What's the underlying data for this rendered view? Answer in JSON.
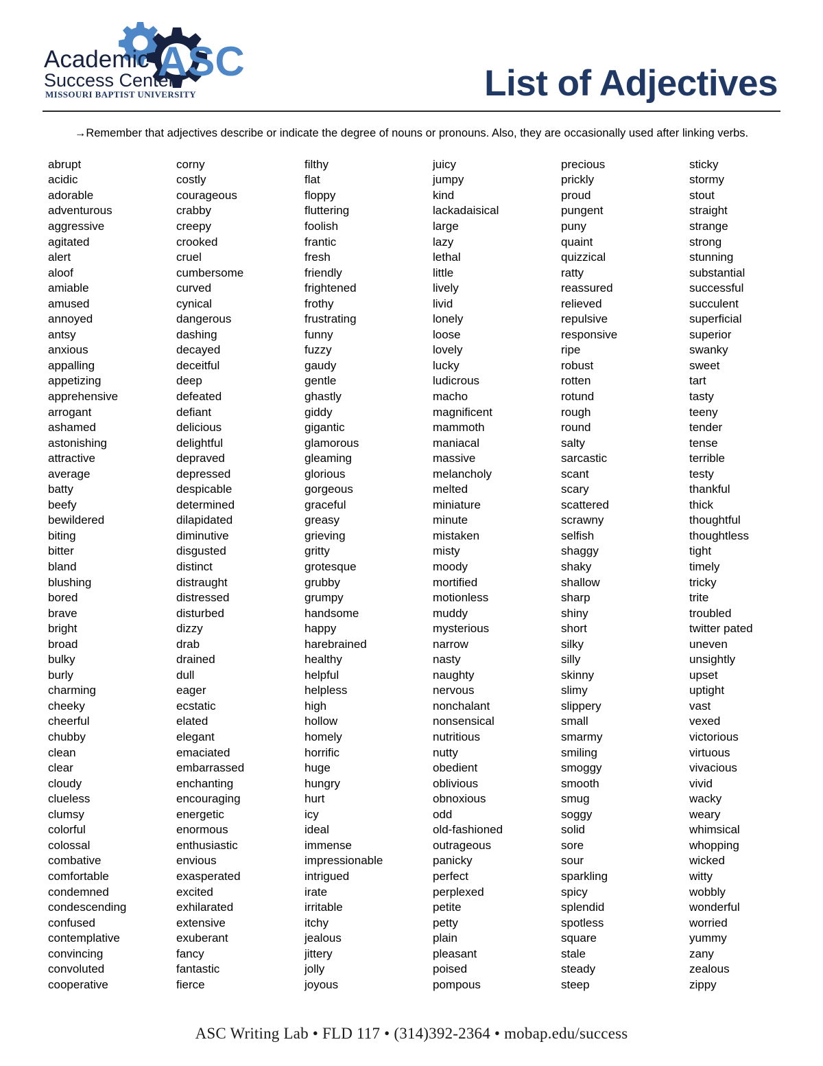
{
  "header": {
    "title": "List of Adjectives",
    "logo": {
      "line1": "Academic",
      "line2": "Success Center",
      "line3": "MISSOURI BAPTIST UNIVERSITY",
      "mark": "ASC",
      "icon": "gear-icon",
      "color_dark": "#1F3864",
      "color_light": "#4E87C7"
    }
  },
  "subtitle": {
    "arrow": "→",
    "text": "Remember that adjectives describe or indicate the degree of nouns or pronouns.  Also, they are occasionally used after linking verbs."
  },
  "columns": [
    {
      "id": "column-1",
      "words": [
        "abrupt",
        "acidic",
        "adorable",
        "adventurous",
        "aggressive",
        "agitated",
        "alert",
        "aloof",
        "amiable",
        "amused",
        "annoyed",
        "antsy",
        "anxious",
        "appalling",
        "appetizing",
        "apprehensive",
        "arrogant",
        "ashamed",
        "astonishing",
        "attractive",
        "average",
        "batty",
        "beefy",
        "bewildered",
        "biting",
        "bitter",
        "bland",
        "blushing",
        "bored",
        "brave",
        "bright",
        "broad",
        "bulky",
        "burly",
        "charming",
        "cheeky",
        "cheerful",
        "chubby",
        "clean",
        "clear",
        "cloudy",
        "clueless",
        "clumsy",
        "colorful",
        "colossal",
        "combative",
        "comfortable",
        "condemned",
        "condescending",
        "confused",
        "contemplative",
        "convincing",
        "convoluted",
        "cooperative"
      ]
    },
    {
      "id": "column-2",
      "words": [
        "corny",
        "costly",
        "courageous",
        "crabby",
        "creepy",
        "crooked",
        "cruel",
        "cumbersome",
        "curved",
        "cynical",
        "dangerous",
        "dashing",
        "decayed",
        "deceitful",
        "deep",
        "defeated",
        "defiant",
        "delicious",
        "delightful",
        "depraved",
        "depressed",
        "despicable",
        "determined",
        "dilapidated",
        "diminutive",
        "disgusted",
        "distinct",
        "distraught",
        "distressed",
        "disturbed",
        "dizzy",
        "drab",
        "drained",
        "dull",
        "eager",
        "ecstatic",
        "elated",
        "elegant",
        "emaciated",
        "embarrassed",
        "enchanting",
        "encouraging",
        "energetic",
        "enormous",
        "enthusiastic",
        "envious",
        "exasperated",
        "excited",
        "exhilarated",
        "extensive",
        "exuberant",
        "fancy",
        "fantastic",
        "fierce"
      ]
    },
    {
      "id": "column-3",
      "words": [
        "filthy",
        "flat",
        "floppy",
        "fluttering",
        "foolish",
        "frantic",
        "fresh",
        "friendly",
        "frightened",
        "frothy",
        "frustrating",
        "funny",
        "fuzzy",
        "gaudy",
        "gentle",
        "ghastly",
        "giddy",
        "gigantic",
        "glamorous",
        "gleaming",
        "glorious",
        "gorgeous",
        "graceful",
        "greasy",
        "grieving",
        "gritty",
        "grotesque",
        "grubby",
        "grumpy",
        "handsome",
        "happy",
        "harebrained",
        "healthy",
        "helpful",
        "helpless",
        "high",
        "hollow",
        "homely",
        "horrific",
        "huge",
        "hungry",
        "hurt",
        "icy",
        "ideal",
        "immense",
        "impressionable",
        "intrigued",
        "irate",
        "irritable",
        "itchy",
        "jealous",
        "jittery",
        "jolly",
        "joyous"
      ]
    },
    {
      "id": "column-4",
      "words": [
        "juicy",
        "jumpy",
        "kind",
        "lackadaisical",
        "large",
        "lazy",
        "lethal",
        "little",
        "lively",
        "livid",
        "lonely",
        "loose",
        "lovely",
        "lucky",
        "ludicrous",
        "macho",
        "magnificent",
        "mammoth",
        "maniacal",
        "massive",
        "melancholy",
        "melted",
        "miniature",
        "minute",
        "mistaken",
        "misty",
        "moody",
        "mortified",
        "motionless",
        "muddy",
        "mysterious",
        "narrow",
        "nasty",
        "naughty",
        "nervous",
        "nonchalant",
        "nonsensical",
        "nutritious",
        "nutty",
        "obedient",
        "oblivious",
        "obnoxious",
        "odd",
        "old-fashioned",
        "outrageous",
        "panicky",
        "perfect",
        "perplexed",
        "petite",
        "petty",
        "plain",
        "pleasant",
        "poised",
        "pompous"
      ]
    },
    {
      "id": "column-5",
      "words": [
        "precious",
        "prickly",
        "proud",
        "pungent",
        "puny",
        "quaint",
        "quizzical",
        "ratty",
        "reassured",
        "relieved",
        "repulsive",
        "responsive",
        "ripe",
        "robust",
        "rotten",
        "rotund",
        "rough",
        "round",
        "salty",
        "sarcastic",
        "scant",
        "scary",
        "scattered",
        "scrawny",
        "selfish",
        "shaggy",
        "shaky",
        "shallow",
        "sharp",
        "shiny",
        "short",
        "silky",
        "silly",
        "skinny",
        "slimy",
        "slippery",
        "small",
        "smarmy",
        "smiling",
        "smoggy",
        "smooth",
        "smug",
        "soggy",
        "solid",
        "sore",
        "sour",
        "sparkling",
        "spicy",
        "splendid",
        "spotless",
        "square",
        "stale",
        "steady",
        "steep"
      ]
    },
    {
      "id": "column-6",
      "words": [
        "sticky",
        "stormy",
        "stout",
        "straight",
        "strange",
        "strong",
        "stunning",
        "substantial",
        "successful",
        "succulent",
        "superficial",
        "superior",
        "swanky",
        "sweet",
        "tart",
        "tasty",
        "teeny",
        "tender",
        "tense",
        "terrible",
        "testy",
        "thankful",
        "thick",
        "thoughtful",
        "thoughtless",
        "tight",
        "timely",
        "tricky",
        "trite",
        "troubled",
        "twitter pated",
        "uneven",
        "unsightly",
        "upset",
        "uptight",
        "vast",
        "vexed",
        "victorious",
        "virtuous",
        "vivacious",
        "vivid",
        "wacky",
        "weary",
        "whimsical",
        "whopping",
        "wicked",
        "witty",
        "wobbly",
        "wonderful",
        "worried",
        "yummy",
        "zany",
        "zealous",
        "zippy"
      ]
    }
  ],
  "footer": {
    "text": "ASC Writing Lab • FLD 117 • (314)392-2364 • mobap.edu/success"
  }
}
